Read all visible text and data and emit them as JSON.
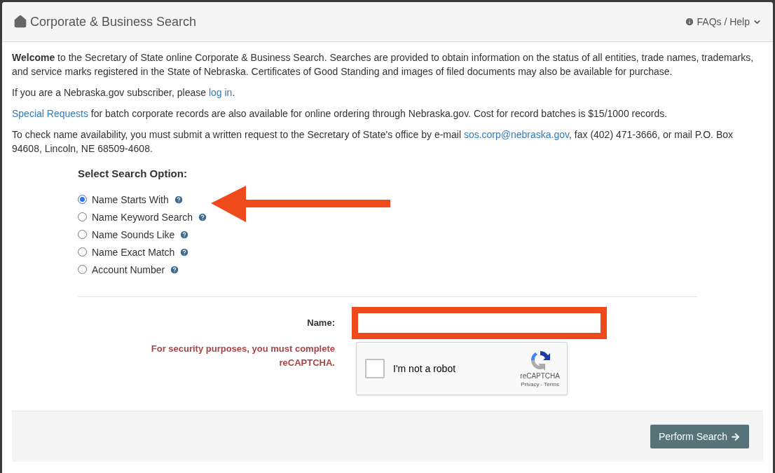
{
  "header": {
    "title": "Corporate & Business Search",
    "help_menu": "FAQs / Help"
  },
  "intro": [
    {
      "kind": "text",
      "text": "**Welcome** to the Secretary of State online Corporate & Business Search. Searches are provided to obtain information on the status of all entities, trade names, trademarks, and service marks registered in the State of Nebraska. Certificates of Good Standing and images of filed documents may also be available for purchase."
    },
    {
      "kind": "link_after",
      "before": "If you are a Nebraska.gov subscriber, please ",
      "link": "log in",
      "after": "."
    },
    {
      "kind": "link_before",
      "link": "Special Requests",
      "after": " for batch corporate records are also available for online ordering through Nebraska.gov. Cost for record batches is $15/1000 records."
    },
    {
      "kind": "link_mid",
      "before": "To check name availability, you must submit a written request to the Secretary of State's office by e-mail ",
      "link": "sos.corp@nebraska.gov",
      "after": ", fax (402) 471-3666, or mail P.O. Box 94608, Lincoln, NE 68509-4608."
    }
  ],
  "search_options": {
    "heading": "Select Search Option:",
    "options": [
      {
        "label": "Name Starts With",
        "selected": true
      },
      {
        "label": "Name Keyword Search",
        "selected": false
      },
      {
        "label": "Name Sounds Like",
        "selected": false
      },
      {
        "label": "Name Exact Match",
        "selected": false
      },
      {
        "label": "Account Number",
        "selected": false
      }
    ]
  },
  "form": {
    "name_label": "Name:",
    "security_message": "For security purposes, you must complete reCAPTCHA.",
    "captcha": {
      "label": "I'm not a robot",
      "checked": false,
      "brand": "reCAPTCHA",
      "privacy": "Privacy",
      "separator": "-",
      "terms": "Terms"
    }
  },
  "footer": {
    "submit_button": "Perform Search"
  }
}
